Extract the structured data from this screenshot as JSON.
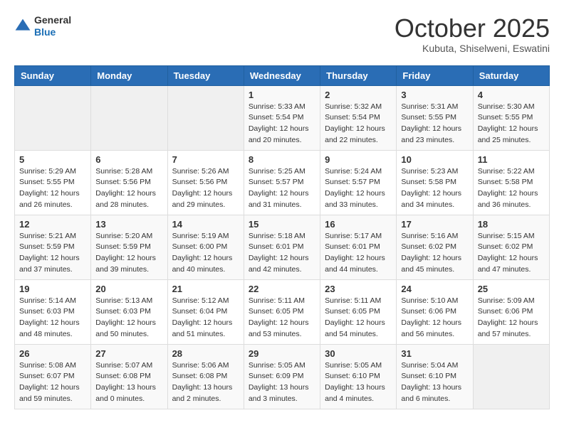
{
  "logo": {
    "general": "General",
    "blue": "Blue"
  },
  "header": {
    "month": "October 2025",
    "location": "Kubuta, Shiselweni, Eswatini"
  },
  "weekdays": [
    "Sunday",
    "Monday",
    "Tuesday",
    "Wednesday",
    "Thursday",
    "Friday",
    "Saturday"
  ],
  "weeks": [
    [
      {
        "day": "",
        "info": ""
      },
      {
        "day": "",
        "info": ""
      },
      {
        "day": "",
        "info": ""
      },
      {
        "day": "1",
        "info": "Sunrise: 5:33 AM\nSunset: 5:54 PM\nDaylight: 12 hours\nand 20 minutes."
      },
      {
        "day": "2",
        "info": "Sunrise: 5:32 AM\nSunset: 5:54 PM\nDaylight: 12 hours\nand 22 minutes."
      },
      {
        "day": "3",
        "info": "Sunrise: 5:31 AM\nSunset: 5:55 PM\nDaylight: 12 hours\nand 23 minutes."
      },
      {
        "day": "4",
        "info": "Sunrise: 5:30 AM\nSunset: 5:55 PM\nDaylight: 12 hours\nand 25 minutes."
      }
    ],
    [
      {
        "day": "5",
        "info": "Sunrise: 5:29 AM\nSunset: 5:55 PM\nDaylight: 12 hours\nand 26 minutes."
      },
      {
        "day": "6",
        "info": "Sunrise: 5:28 AM\nSunset: 5:56 PM\nDaylight: 12 hours\nand 28 minutes."
      },
      {
        "day": "7",
        "info": "Sunrise: 5:26 AM\nSunset: 5:56 PM\nDaylight: 12 hours\nand 29 minutes."
      },
      {
        "day": "8",
        "info": "Sunrise: 5:25 AM\nSunset: 5:57 PM\nDaylight: 12 hours\nand 31 minutes."
      },
      {
        "day": "9",
        "info": "Sunrise: 5:24 AM\nSunset: 5:57 PM\nDaylight: 12 hours\nand 33 minutes."
      },
      {
        "day": "10",
        "info": "Sunrise: 5:23 AM\nSunset: 5:58 PM\nDaylight: 12 hours\nand 34 minutes."
      },
      {
        "day": "11",
        "info": "Sunrise: 5:22 AM\nSunset: 5:58 PM\nDaylight: 12 hours\nand 36 minutes."
      }
    ],
    [
      {
        "day": "12",
        "info": "Sunrise: 5:21 AM\nSunset: 5:59 PM\nDaylight: 12 hours\nand 37 minutes."
      },
      {
        "day": "13",
        "info": "Sunrise: 5:20 AM\nSunset: 5:59 PM\nDaylight: 12 hours\nand 39 minutes."
      },
      {
        "day": "14",
        "info": "Sunrise: 5:19 AM\nSunset: 6:00 PM\nDaylight: 12 hours\nand 40 minutes."
      },
      {
        "day": "15",
        "info": "Sunrise: 5:18 AM\nSunset: 6:01 PM\nDaylight: 12 hours\nand 42 minutes."
      },
      {
        "day": "16",
        "info": "Sunrise: 5:17 AM\nSunset: 6:01 PM\nDaylight: 12 hours\nand 44 minutes."
      },
      {
        "day": "17",
        "info": "Sunrise: 5:16 AM\nSunset: 6:02 PM\nDaylight: 12 hours\nand 45 minutes."
      },
      {
        "day": "18",
        "info": "Sunrise: 5:15 AM\nSunset: 6:02 PM\nDaylight: 12 hours\nand 47 minutes."
      }
    ],
    [
      {
        "day": "19",
        "info": "Sunrise: 5:14 AM\nSunset: 6:03 PM\nDaylight: 12 hours\nand 48 minutes."
      },
      {
        "day": "20",
        "info": "Sunrise: 5:13 AM\nSunset: 6:03 PM\nDaylight: 12 hours\nand 50 minutes."
      },
      {
        "day": "21",
        "info": "Sunrise: 5:12 AM\nSunset: 6:04 PM\nDaylight: 12 hours\nand 51 minutes."
      },
      {
        "day": "22",
        "info": "Sunrise: 5:11 AM\nSunset: 6:05 PM\nDaylight: 12 hours\nand 53 minutes."
      },
      {
        "day": "23",
        "info": "Sunrise: 5:11 AM\nSunset: 6:05 PM\nDaylight: 12 hours\nand 54 minutes."
      },
      {
        "day": "24",
        "info": "Sunrise: 5:10 AM\nSunset: 6:06 PM\nDaylight: 12 hours\nand 56 minutes."
      },
      {
        "day": "25",
        "info": "Sunrise: 5:09 AM\nSunset: 6:06 PM\nDaylight: 12 hours\nand 57 minutes."
      }
    ],
    [
      {
        "day": "26",
        "info": "Sunrise: 5:08 AM\nSunset: 6:07 PM\nDaylight: 12 hours\nand 59 minutes."
      },
      {
        "day": "27",
        "info": "Sunrise: 5:07 AM\nSunset: 6:08 PM\nDaylight: 13 hours\nand 0 minutes."
      },
      {
        "day": "28",
        "info": "Sunrise: 5:06 AM\nSunset: 6:08 PM\nDaylight: 13 hours\nand 2 minutes."
      },
      {
        "day": "29",
        "info": "Sunrise: 5:05 AM\nSunset: 6:09 PM\nDaylight: 13 hours\nand 3 minutes."
      },
      {
        "day": "30",
        "info": "Sunrise: 5:05 AM\nSunset: 6:10 PM\nDaylight: 13 hours\nand 4 minutes."
      },
      {
        "day": "31",
        "info": "Sunrise: 5:04 AM\nSunset: 6:10 PM\nDaylight: 13 hours\nand 6 minutes."
      },
      {
        "day": "",
        "info": ""
      }
    ]
  ]
}
